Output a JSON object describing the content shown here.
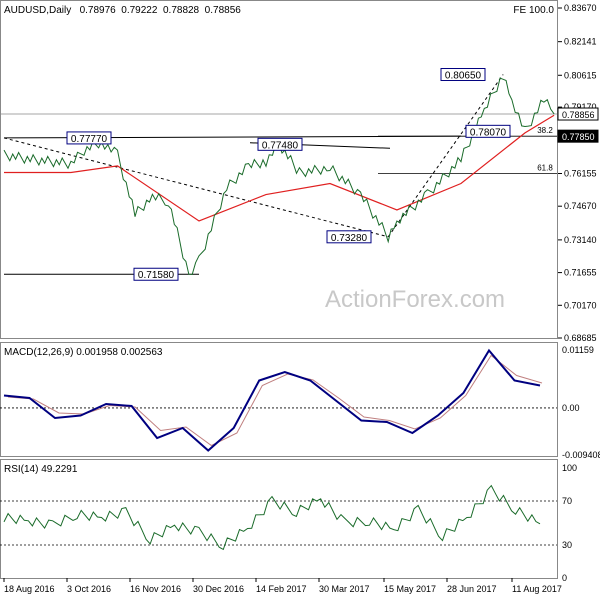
{
  "header": {
    "symbol_line": "AUDUSD,Daily   0.78976  0.79222  0.78828  0.78856",
    "fe_label": "FE 100.0"
  },
  "watermark": "ActionForex.com",
  "colors": {
    "price": "#1a6b2a",
    "ma": "#e02020",
    "trend": "#000000",
    "macd_main": "#000080",
    "macd_signal": "#c08080",
    "rsi": "#1a6b2a",
    "grid": "#c0c0c0",
    "label_border": "#000080"
  },
  "price_axis": {
    "ticks": [
      "0.83670",
      "0.82141",
      "0.80615",
      "0.79170",
      "0.77795",
      "0.76155",
      "0.74670",
      "0.73140",
      "0.71655",
      "0.70170",
      "0.68685"
    ],
    "current_label": "0.78856",
    "marker_label": "0.77850"
  },
  "annotations": {
    "labels": [
      "0.80650",
      "0.78070",
      "0.77770",
      "0.77480",
      "0.73280",
      "0.71580"
    ],
    "fib_382": "38.2",
    "fib_618": "61.8"
  },
  "macd": {
    "title": "MACD(12,26,9)  0.001958  0.002563",
    "ticks": [
      "0.01159",
      "0.00",
      "-0.009408"
    ]
  },
  "rsi": {
    "title": "RSI(14)  49.2291",
    "ticks": [
      "100",
      "70",
      "30",
      "0"
    ]
  },
  "x_axis": {
    "ticks": [
      "18 Aug 2016",
      "3 Oct 2016",
      "16 Nov 2016",
      "30 Dec 2016",
      "14 Feb 2017",
      "30 Mar 2017",
      "15 May 2017",
      "28 Jun 2017",
      "11 Aug 2017"
    ]
  },
  "chart_data": [
    {
      "type": "line",
      "title": "AUDUSD,Daily",
      "series": [
        {
          "name": "",
          "points": [
            [
              "18 Aug 2016",
              0.77
            ],
            [
              "5 Sep 2016",
              0.768
            ],
            [
              "3 Oct 2016",
              0.766
            ],
            [
              "12 Oct 2016",
              0.772
            ],
            [
              "24 Oct 2016",
              0.776
            ],
            [
              "4 Nov 2016",
              0.77
            ],
            [
              "16 Nov 2016",
              0.743
            ],
            [
              "28 Nov 2016",
              0.751
            ],
            [
              "9 Dec 2016",
              0.749
            ],
            [
              "23 Dec 2016",
              0.7158
            ],
            [
              "30 Dec 2016",
              0.722
            ],
            [
              "18 Jan 2017",
              0.755
            ],
            [
              "2 Feb 2017",
              0.765
            ],
            [
              "14 Feb 2017",
              0.767
            ],
            [
              "23 Feb 2017",
              0.7748
            ],
            [
              "9 Mar 2017",
              0.762
            ],
            [
              "30 Mar 2017",
              0.764
            ],
            [
              "20 Apr 2017",
              0.752
            ],
            [
              "9 May 2017",
              0.7328
            ],
            [
              "15 May 2017",
              0.74
            ],
            [
              "5 Jun 2017",
              0.752
            ],
            [
              "28 Jun 2017",
              0.768
            ],
            [
              "14 Jul 2017",
              0.79
            ],
            [
              "27 Jul 2017",
              0.8065
            ],
            [
              "2 Aug 2017",
              0.795
            ],
            [
              "11 Aug 2017",
              0.7807
            ],
            [
              "24 Aug 2017",
              0.795
            ],
            [
              "31 Aug 2017",
              0.7886
            ]
          ]
        }
      ],
      "overlays": {
        "moving_average": [
          [
            "18 Aug 2016",
            0.762
          ],
          [
            "3 Oct 2016",
            0.762
          ],
          [
            "4 Nov 2016",
            0.765
          ],
          [
            "30 Dec 2016",
            0.74
          ],
          [
            "14 Feb 2017",
            0.752
          ],
          [
            "30 Mar 2017",
            0.757
          ],
          [
            "15 May 2017",
            0.745
          ],
          [
            "28 Jun 2017",
            0.757
          ],
          [
            "11 Aug 2017",
            0.78
          ],
          [
            "31 Aug 2017",
            0.788
          ]
        ],
        "trend_lines": [
          {
            "from": [
              "18 Aug 2016",
              0.7777
            ],
            "to": [
              "28 Jun 2017",
              0.7785
            ]
          },
          {
            "from": [
              "18 Aug 2016",
              0.7158
            ],
            "to": [
              "30 Dec 2016",
              0.7158
            ]
          },
          {
            "from": [
              "18 Aug 2016",
              0.7777
            ],
            "to": [
              "9 May 2017",
              0.7328
            ]
          },
          {
            "from": [
              "9 May 2017",
              0.7328
            ],
            "to": [
              "27 Jul 2017",
              0.8065
            ]
          }
        ],
        "fibonacci": [
          {
            "level": "38.2",
            "value": 0.7785
          },
          {
            "level": "61.8",
            "value": 0.7615
          }
        ],
        "horizontal_lines": [
          0.7785,
          0.78856
        ]
      },
      "ylim": [
        0.68685,
        0.8367
      ]
    },
    {
      "type": "line",
      "title": "MACD(12,26,9)",
      "series": [
        {
          "name": "",
          "values": [
            0.0025,
            0.002,
            -0.002,
            -0.0015,
            0.0008,
            0.0004,
            -0.006,
            -0.004,
            -0.0085,
            -0.004,
            0.0055,
            0.0072,
            0.0055,
            0.0015,
            -0.0025,
            -0.0028,
            -0.005,
            -0.0015,
            0.003,
            0.0115,
            0.0055,
            0.0045
          ]
        },
        {
          "name": "",
          "values": [
            0.0022,
            0.0018,
            -0.001,
            -0.0012,
            0.0005,
            0.0002,
            -0.0045,
            -0.0038,
            -0.0075,
            -0.005,
            0.0045,
            0.0068,
            0.0056,
            0.002,
            -0.0018,
            -0.0025,
            -0.0042,
            -0.002,
            0.0025,
            0.0105,
            0.0065,
            0.005
          ]
        }
      ],
      "ylim": [
        -0.009408,
        0.01159
      ]
    },
    {
      "type": "line",
      "title": "RSI(14)",
      "series": [
        {
          "name": "",
          "values": [
            55,
            52,
            48,
            58,
            55,
            60,
            35,
            48,
            42,
            30,
            45,
            70,
            60,
            72,
            50,
            52,
            44,
            62,
            38,
            55,
            80,
            62,
            49.2291
          ]
        }
      ],
      "ylim": [
        0,
        100
      ],
      "levels": [
        70,
        30
      ]
    }
  ]
}
